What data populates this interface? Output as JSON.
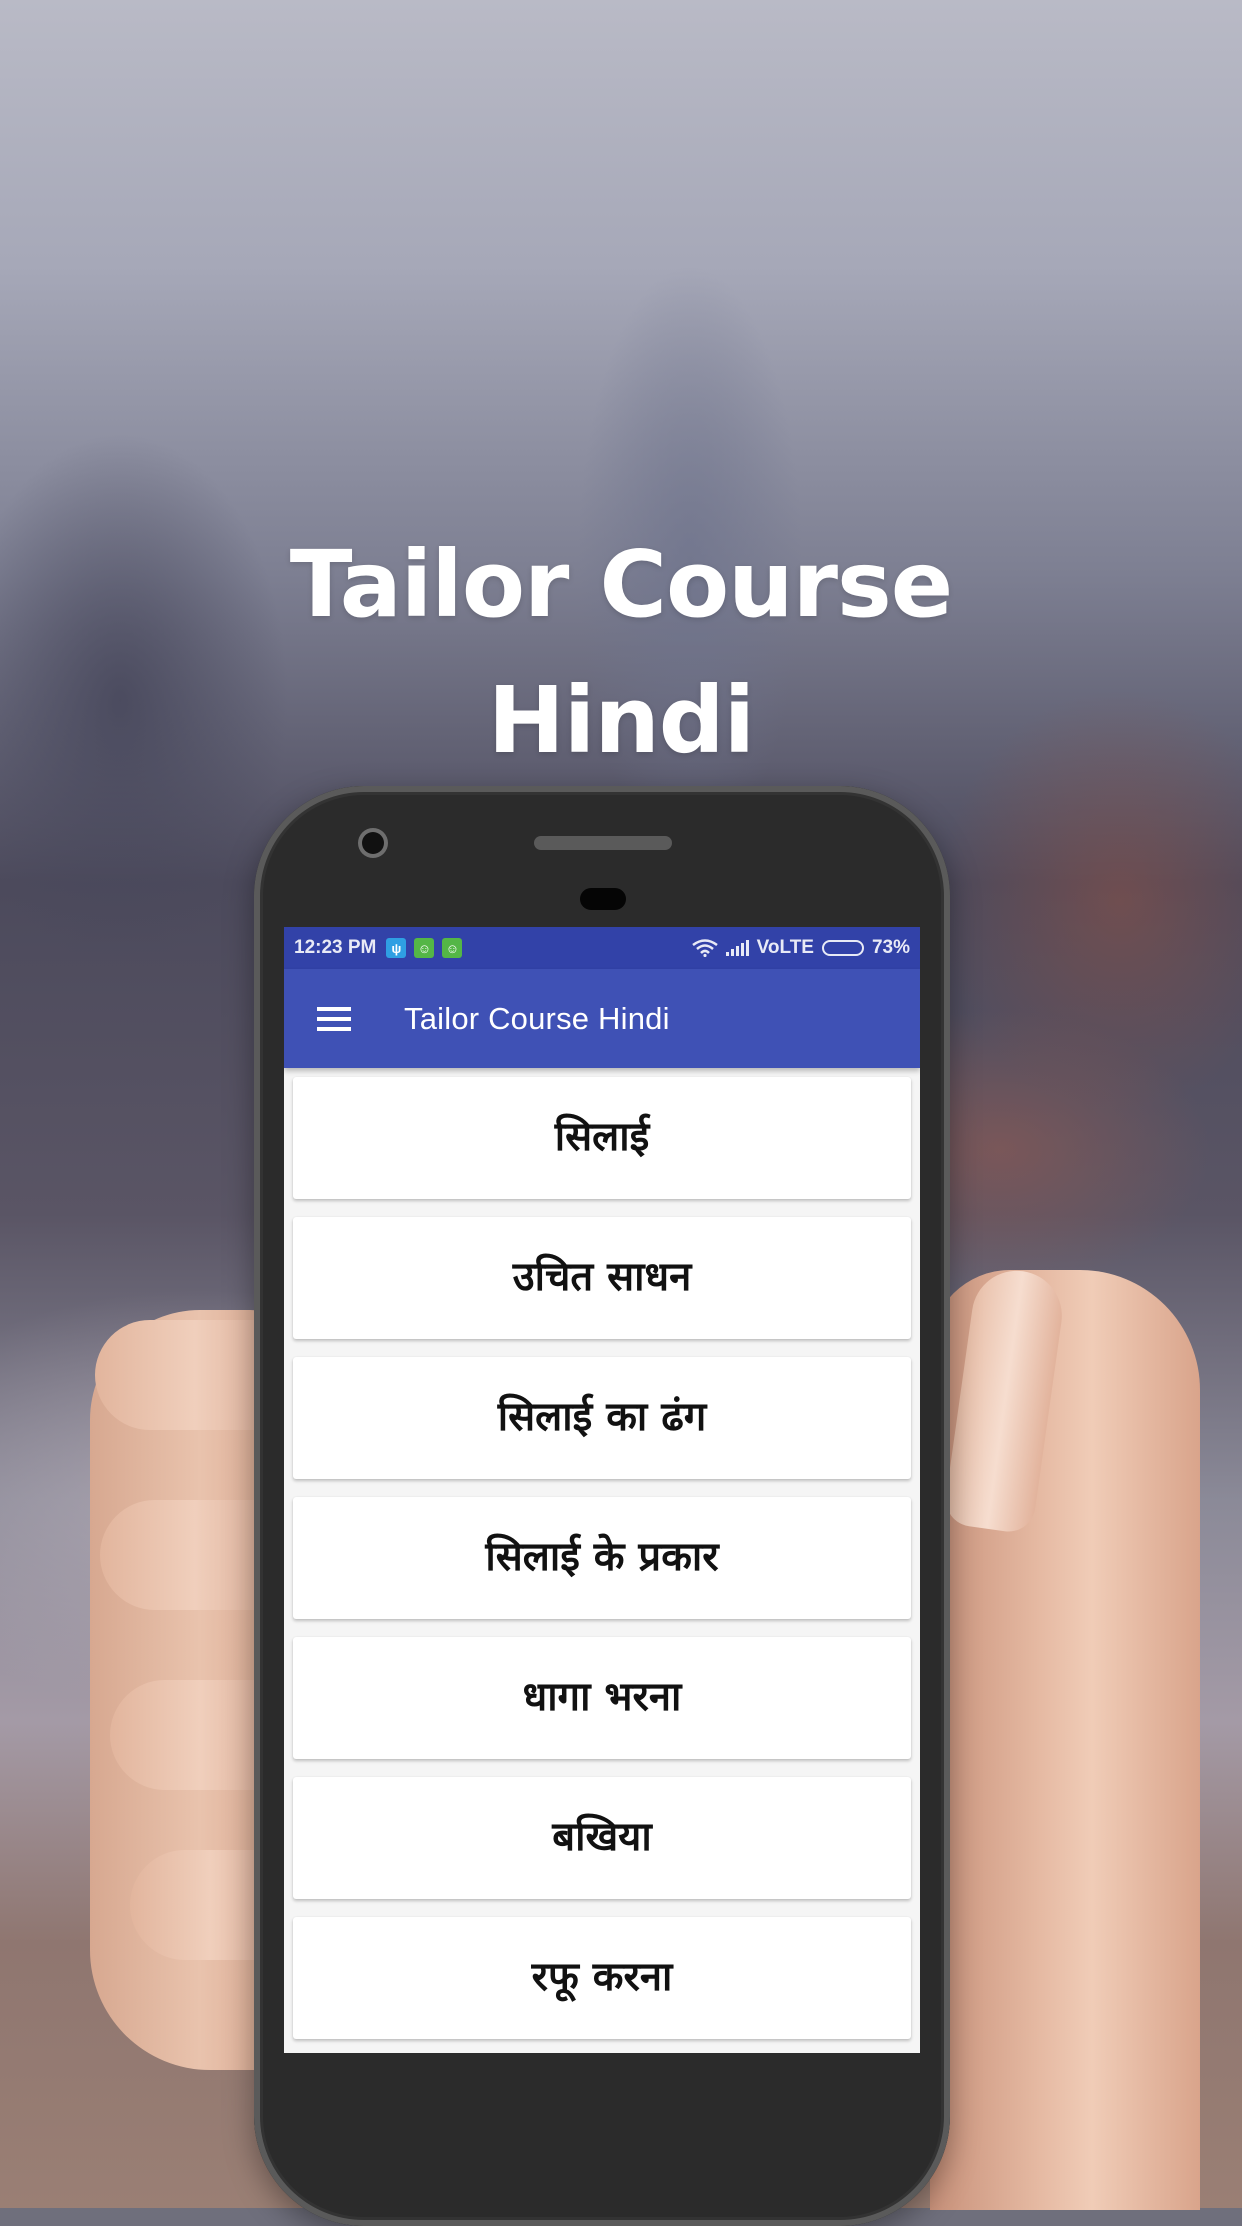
{
  "promo": {
    "headline_line1": "Tailor Course",
    "headline_line2": "Hindi"
  },
  "status_bar": {
    "time": "12:23 PM",
    "notification_icons": [
      "usb-icon",
      "android-debug-icon",
      "android-debug-icon"
    ],
    "network": "VoLTE",
    "battery_percent": "73%",
    "battery_level": 0.73
  },
  "app_bar": {
    "menu_icon": "hamburger-menu-icon",
    "title": "Tailor Course Hindi"
  },
  "topics": [
    {
      "label": "सिलाई"
    },
    {
      "label": "उचित साधन"
    },
    {
      "label": "सिलाई का ढंग"
    },
    {
      "label": "सिलाई के प्रकार"
    },
    {
      "label": "धागा भरना"
    },
    {
      "label": "बखिया"
    },
    {
      "label": "रफू करना"
    }
  ],
  "colors": {
    "status_bar": "#3242a8",
    "app_bar": "#3f51b5",
    "list_background": "#f5f5f5",
    "card": "#ffffff"
  }
}
